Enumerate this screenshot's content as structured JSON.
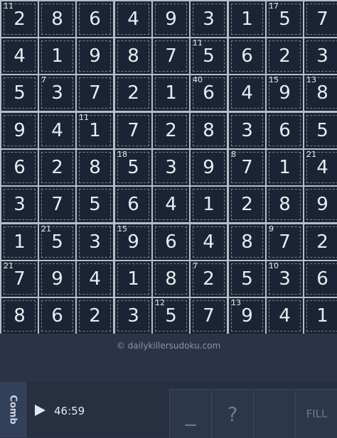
{
  "grid": {
    "digits": [
      [
        2,
        8,
        6,
        4,
        9,
        3,
        1,
        5,
        7
      ],
      [
        4,
        1,
        9,
        8,
        7,
        5,
        6,
        2,
        3
      ],
      [
        5,
        3,
        7,
        2,
        1,
        6,
        4,
        9,
        8
      ],
      [
        9,
        4,
        1,
        7,
        2,
        8,
        3,
        6,
        5
      ],
      [
        6,
        2,
        8,
        5,
        3,
        9,
        7,
        1,
        4
      ],
      [
        3,
        7,
        5,
        6,
        4,
        1,
        2,
        8,
        9
      ],
      [
        1,
        5,
        3,
        9,
        6,
        4,
        8,
        7,
        2
      ],
      [
        7,
        9,
        4,
        1,
        8,
        2,
        5,
        3,
        6
      ],
      [
        8,
        6,
        2,
        3,
        5,
        7,
        9,
        4,
        1
      ]
    ],
    "cage_sums": [
      {
        "row": 0,
        "col": 0,
        "sum": "11"
      },
      {
        "row": 0,
        "col": 7,
        "sum": "17"
      },
      {
        "row": 1,
        "col": 5,
        "sum": "11"
      },
      {
        "row": 2,
        "col": 1,
        "sum": "7"
      },
      {
        "row": 2,
        "col": 5,
        "sum": "40"
      },
      {
        "row": 2,
        "col": 7,
        "sum": "15"
      },
      {
        "row": 2,
        "col": 8,
        "sum": "13"
      },
      {
        "row": 3,
        "col": 2,
        "sum": "11"
      },
      {
        "row": 4,
        "col": 3,
        "sum": "18"
      },
      {
        "row": 4,
        "col": 6,
        "sum": "8"
      },
      {
        "row": 4,
        "col": 8,
        "sum": "21"
      },
      {
        "row": 6,
        "col": 1,
        "sum": "21"
      },
      {
        "row": 6,
        "col": 3,
        "sum": "15"
      },
      {
        "row": 6,
        "col": 7,
        "sum": "9"
      },
      {
        "row": 7,
        "col": 0,
        "sum": "21"
      },
      {
        "row": 7,
        "col": 5,
        "sum": "7"
      },
      {
        "row": 7,
        "col": 7,
        "sum": "10"
      },
      {
        "row": 8,
        "col": 4,
        "sum": "12"
      },
      {
        "row": 8,
        "col": 6,
        "sum": "13"
      }
    ]
  },
  "footer": {
    "copyright": "© dailykillersudoku.com"
  },
  "controls": {
    "comb_label": "Comb",
    "timer": "46:59",
    "underscore_label": "_",
    "help_label": "?",
    "fill_label": "FILL"
  },
  "colors": {
    "board_bg": "#1b2434",
    "page_bg": "#2a3446",
    "digit": "#e9ecf1",
    "grid_line": "#b8bcc4"
  }
}
